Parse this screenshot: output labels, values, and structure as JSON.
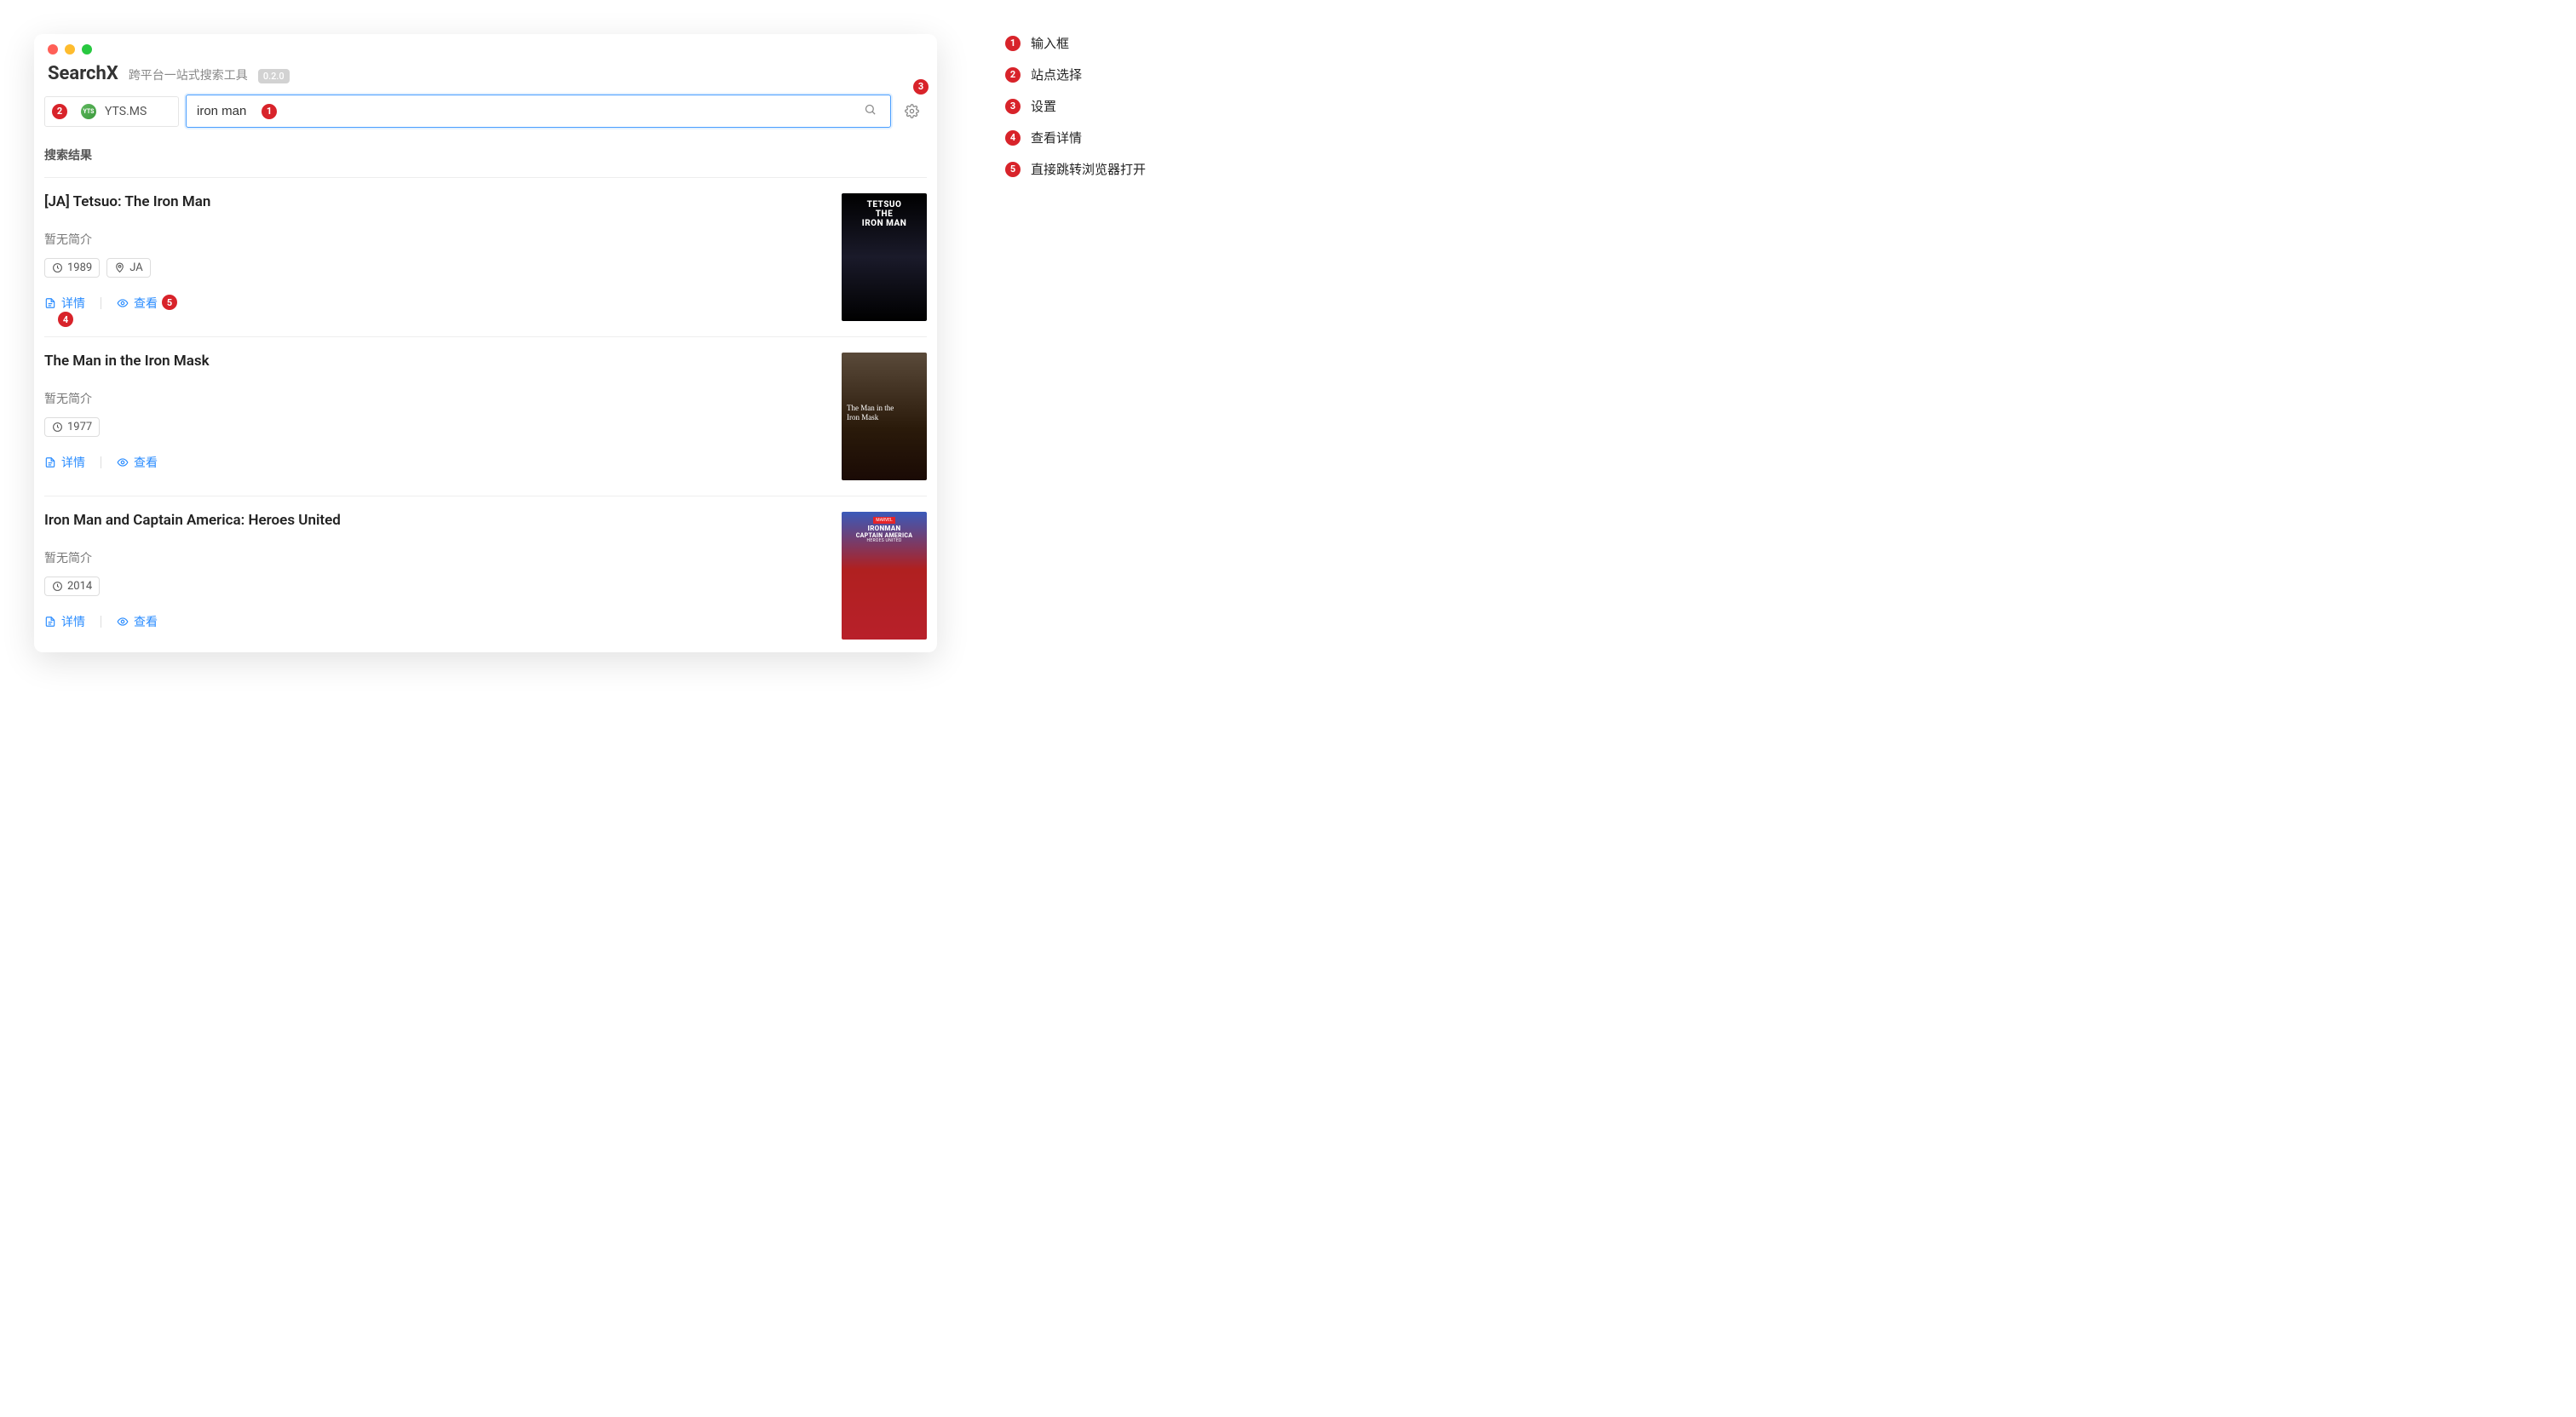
{
  "app": {
    "name": "SearchX",
    "tagline": "跨平台一站式搜索工具",
    "version": "0.2.0"
  },
  "toolbar": {
    "site_label": "YTS.MS",
    "search_value": "iron man"
  },
  "section": {
    "results_title": "搜索结果"
  },
  "results": [
    {
      "title": "[JA] Tetsuo: The Iron Man",
      "summary": "暂无简介",
      "year": "1989",
      "region": "JA",
      "detail_label": "详情",
      "view_label": "查看",
      "poster_lines": [
        "TETSUO",
        "THE",
        "IRON MAN"
      ]
    },
    {
      "title": "The Man in the Iron Mask",
      "summary": "暂无简介",
      "year": "1977",
      "region": null,
      "detail_label": "详情",
      "view_label": "查看",
      "poster_lines": [
        "The Man in the",
        "Iron Mask"
      ]
    },
    {
      "title": "Iron Man and Captain America: Heroes United",
      "summary": "暂无简介",
      "year": "2014",
      "region": null,
      "detail_label": "详情",
      "view_label": "查看",
      "poster_lines": [
        "MARVEL",
        "IRONMAN",
        "CAPTAIN AMERICA",
        "HEROES UNITED"
      ]
    }
  ],
  "legend": [
    {
      "num": "1",
      "text": "输入框"
    },
    {
      "num": "2",
      "text": "站点选择"
    },
    {
      "num": "3",
      "text": "设置"
    },
    {
      "num": "4",
      "text": "查看详情"
    },
    {
      "num": "5",
      "text": "直接跳转浏览器打开"
    }
  ]
}
